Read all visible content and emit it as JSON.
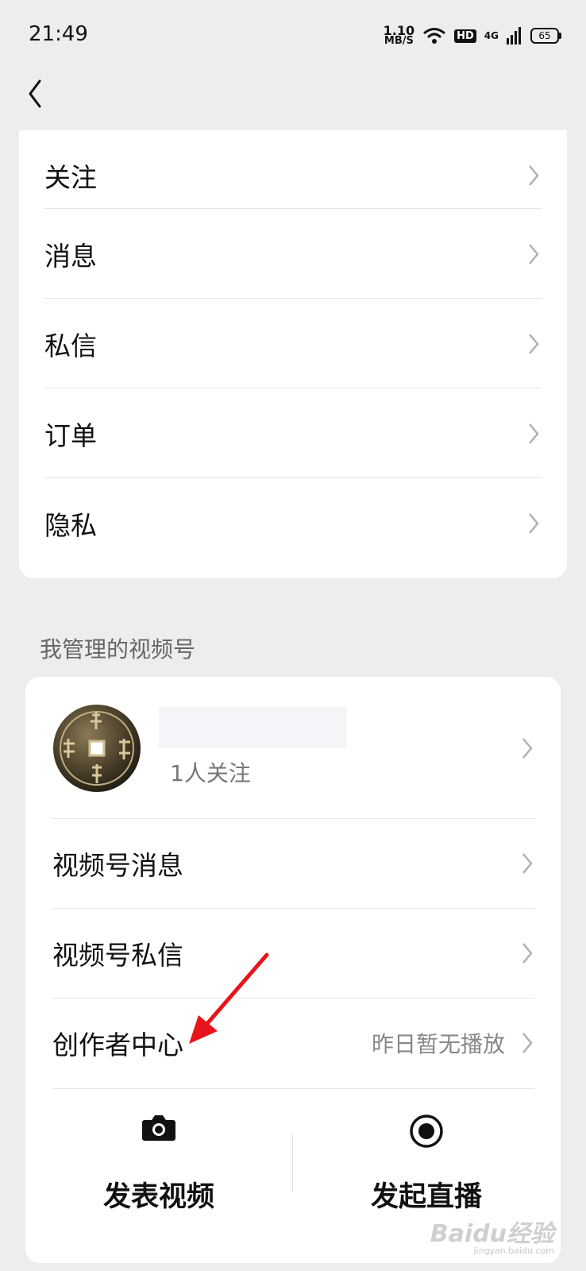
{
  "status_bar": {
    "time": "21:49",
    "net_speed_value": "1.10",
    "net_speed_unit": "MB/S",
    "hd": "HD",
    "network": "4G",
    "battery": "65"
  },
  "menu": {
    "items": [
      {
        "label": "关注"
      },
      {
        "label": "消息"
      },
      {
        "label": "私信"
      },
      {
        "label": "订单"
      },
      {
        "label": "隐私"
      }
    ]
  },
  "channels_section": {
    "title": "我管理的视频号",
    "account": {
      "followers": "1人关注"
    },
    "items": [
      {
        "label": "视频号消息"
      },
      {
        "label": "视频号私信"
      },
      {
        "label": "创作者中心",
        "extra": "昨日暂无播放"
      }
    ],
    "actions": [
      {
        "label": "发表视频",
        "icon": "camera-icon"
      },
      {
        "label": "发起直播",
        "icon": "live-record-icon"
      }
    ]
  },
  "watermark": "Baidu经验",
  "watermark_url": "jingyan.baidu.com",
  "colors": {
    "background": "#ededed",
    "card": "#ffffff",
    "annotation_arrow": "#e8141b"
  }
}
